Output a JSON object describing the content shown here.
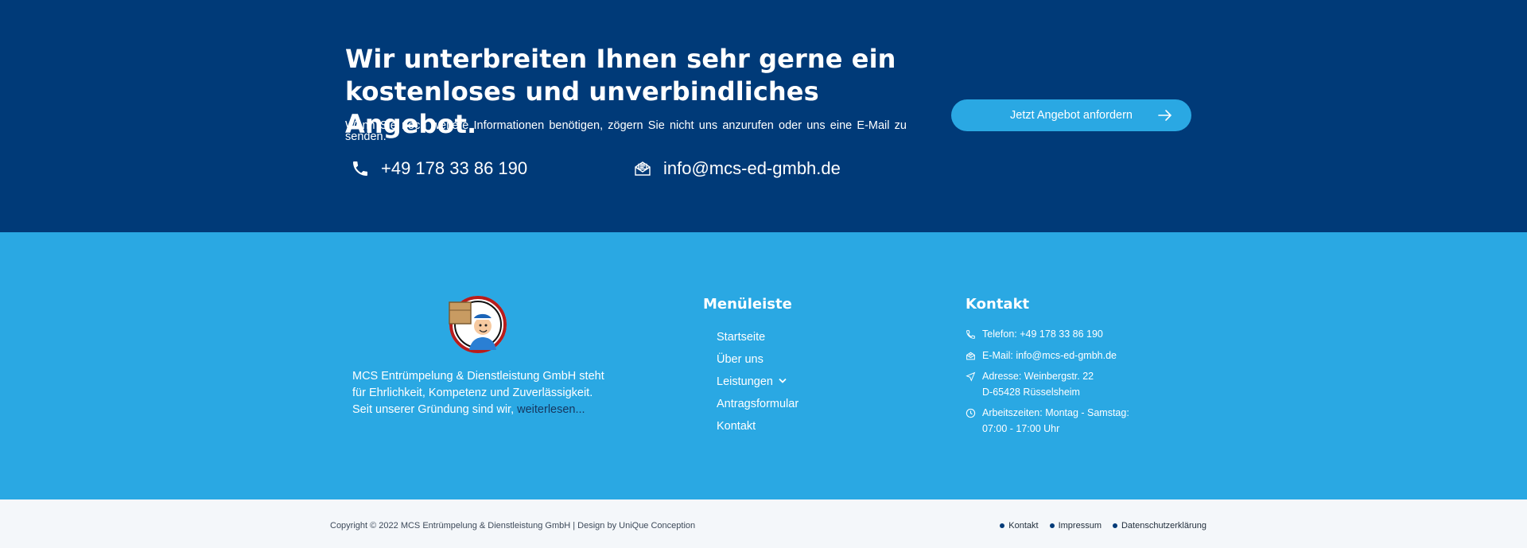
{
  "cta": {
    "title": "Wir unterbreiten Ihnen sehr gerne ein kostenloses und unverbindliches Angebot.",
    "description": "Wenn Sie noch weitere Informationen benötigen, zögern Sie nicht uns anzurufen oder uns eine E-Mail zu senden.",
    "phone": "+49 178 33 86 190",
    "email": "info@mcs-ed-gmbh.de",
    "button_label": "Jetzt Angebot anfordern"
  },
  "footer": {
    "about_text": "MCS Entrümpelung & Dienstleistung GmbH steht für Ehrlichkeit, Kompetenz und Zuverlässigkeit. Seit unserer Gründung sind wir, ",
    "read_more": "weiterlesen...",
    "menu_title": "Menüleiste",
    "menu_items": [
      "Startseite",
      "Über uns",
      "Leistungen",
      "Antragsformular",
      "Kontakt"
    ],
    "kontakt_title": "Kontakt",
    "kontakt": {
      "phone": "Telefon: +49 178 33 86 190",
      "email": "E-Mail: info@mcs-ed-gmbh.de",
      "address_line1": "Adresse: Weinbergstr. 22",
      "address_line2": "D-65428 Rüsselsheim",
      "hours_line1": "Arbeitszeiten: Montag - Samstag:",
      "hours_line2": "07:00 - 17:00 Uhr"
    }
  },
  "bottom": {
    "copyright": "Copyright © 2022 MCS Entrümpelung & Dienstleistung GmbH | Design by UniQue Conception",
    "links": [
      "Kontakt",
      "Impressum",
      "Datenschutzerklärung"
    ]
  },
  "colors": {
    "dark_blue": "#003a78",
    "light_blue": "#2aa8e3",
    "bottom_bg": "#f4f7fa"
  },
  "icons": [
    "phone-icon",
    "mail-icon",
    "arrow-right-icon",
    "chevron-down-icon",
    "location-icon",
    "clock-icon",
    "logo-mascot"
  ]
}
